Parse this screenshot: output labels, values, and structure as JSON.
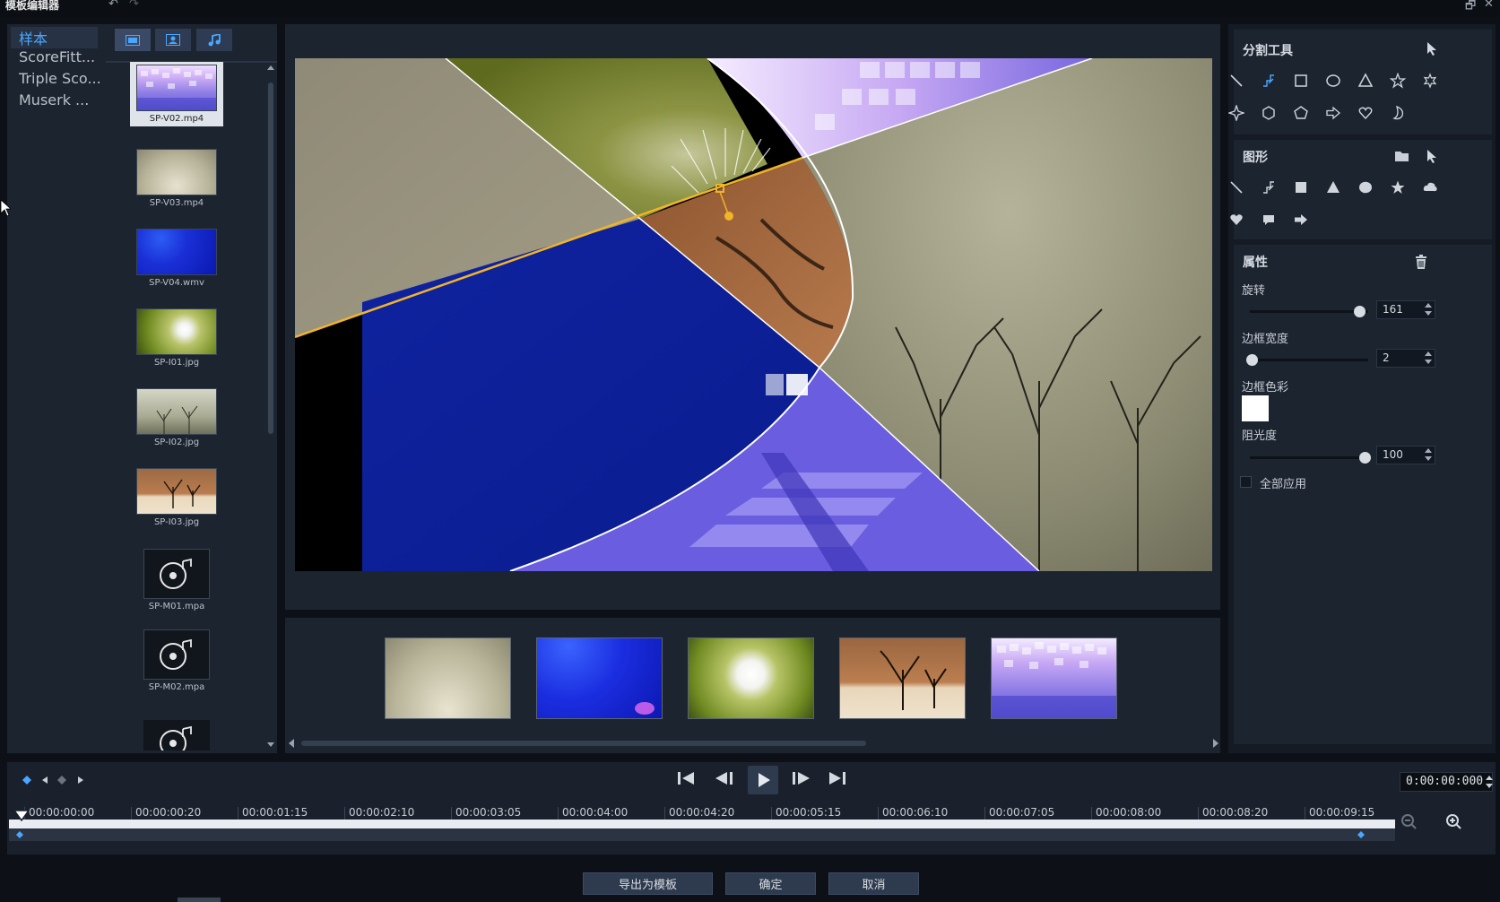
{
  "window": {
    "title": "模板编辑器",
    "undo_icon": "↶",
    "redo_icon": "↷",
    "restore_icon": "🗗",
    "close_icon": "✕"
  },
  "sample_list": {
    "items": [
      {
        "label": "样本",
        "selected": true
      },
      {
        "label": "ScoreFitt..."
      },
      {
        "label": "Triple Sco..."
      },
      {
        "label": "Muserk ..."
      }
    ]
  },
  "library": {
    "tabs": [
      "video-icon",
      "image-icon",
      "music-icon"
    ],
    "items": [
      {
        "label": "SP-V02.mp4",
        "selected": true
      },
      {
        "label": "SP-V03.mp4"
      },
      {
        "label": "SP-V04.wmv"
      },
      {
        "label": "SP-I01.jpg"
      },
      {
        "label": "SP-I02.jpg"
      },
      {
        "label": "SP-I03.jpg"
      },
      {
        "label": "SP-M01.mpa"
      },
      {
        "label": "SP-M02.mpa"
      }
    ]
  },
  "split_tools": {
    "title": "分割工具",
    "icons": [
      "line-icon",
      "polyline-icon",
      "rectangle-outline-icon",
      "ellipse-outline-icon",
      "triangle-outline-icon",
      "star-outline-icon",
      "star6-outline-icon",
      "star4-outline-icon",
      "hexagon-outline-icon",
      "pentagon-outline-icon",
      "arrow-outline-icon",
      "heart-outline-icon",
      "moon-outline-icon"
    ]
  },
  "shapes": {
    "title": "图形",
    "icons": [
      "line-icon",
      "polyline-icon",
      "square-filled-icon",
      "triangle-filled-icon",
      "circle-filled-icon",
      "star-filled-icon",
      "cloud-filled-icon",
      "heart-filled-icon",
      "speech-bubble-icon",
      "arrow-filled-icon"
    ]
  },
  "properties": {
    "title": "属性",
    "rotation": {
      "label": "旋转",
      "value": "161",
      "level": 0.95
    },
    "border_width": {
      "label": "边框宽度",
      "value": "2",
      "level": 0.0
    },
    "border_color": {
      "label": "边框色彩",
      "color": "#ffffff"
    },
    "opacity": {
      "label": "阻光度",
      "value": "100",
      "level": 1.0
    },
    "apply_all": {
      "label": "全部应用",
      "checked": false
    }
  },
  "transport": {
    "timecode": "0:00:00:000",
    "ticks": [
      "00:00:00:00",
      "00:00:00:20",
      "00:00:01:15",
      "00:00:02:10",
      "00:00:03:05",
      "00:00:04:00",
      "00:00:04:20",
      "00:00:05:15",
      "00:00:06:10",
      "00:00:07:05",
      "00:00:08:00",
      "00:00:08:20",
      "00:00:09:15"
    ]
  },
  "buttons": {
    "export": "导出为模板",
    "ok": "确定",
    "cancel": "取消"
  },
  "colors": {
    "accent": "#4aa7ff",
    "selection_line": "#f0b429"
  }
}
